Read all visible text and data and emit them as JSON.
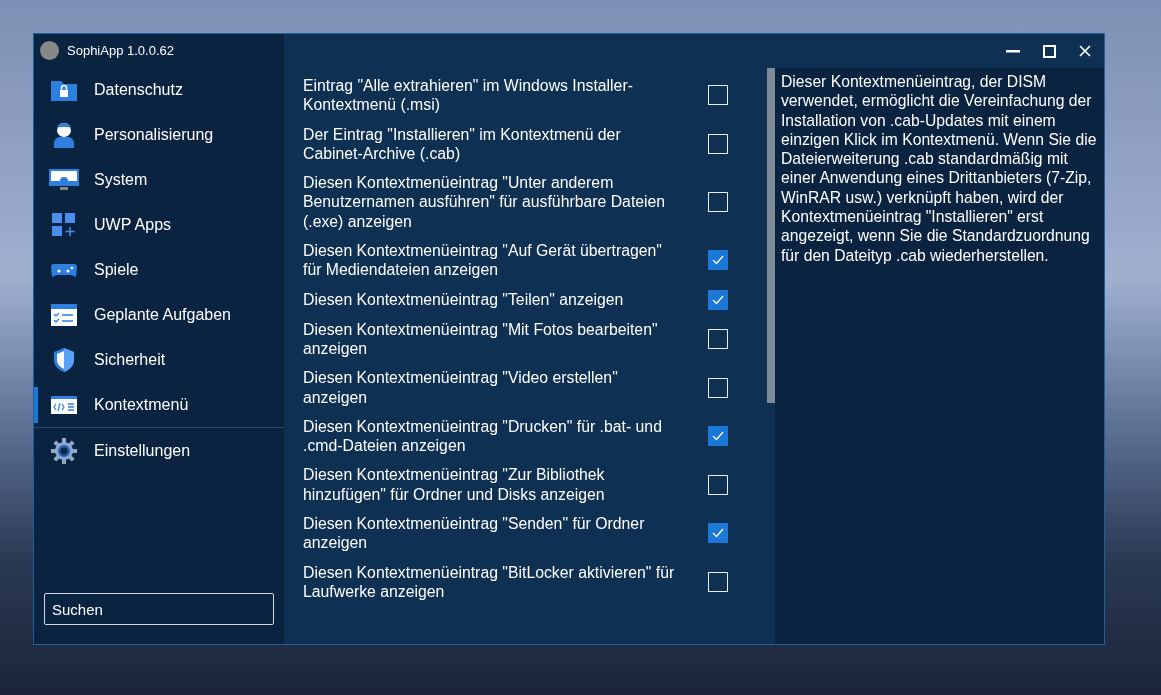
{
  "window": {
    "title": "SophiApp 1.0.0.62"
  },
  "sidebar": {
    "items": [
      {
        "label": "Datenschutz",
        "selected": false
      },
      {
        "label": "Personalisierung",
        "selected": false
      },
      {
        "label": "System",
        "selected": false
      },
      {
        "label": "UWP Apps",
        "selected": false
      },
      {
        "label": "Spiele",
        "selected": false
      },
      {
        "label": "Geplante Aufgaben",
        "selected": false
      },
      {
        "label": "Sicherheit",
        "selected": false
      },
      {
        "label": "Kontextmenü",
        "selected": true
      }
    ],
    "footer_item": {
      "label": "Einstellungen"
    },
    "search": {
      "placeholder": "Suchen"
    }
  },
  "options": [
    {
      "label": "Eintrag \"Alle extrahieren\" im Windows Installer-Kontextmenü (.msi)",
      "checked": false
    },
    {
      "label": "Der Eintrag \"Installieren\" im Kontextmenü der Cabinet-Archive (.cab)",
      "checked": false
    },
    {
      "label": "Diesen Kontextmenüeintrag \"Unter anderem Benutzernamen ausführen\" für ausführbare Dateien (.exe) anzeigen",
      "checked": false
    },
    {
      "label": "Diesen Kontextmenüeintrag \"Auf Gerät übertragen\" für Mediendateien anzeigen",
      "checked": true
    },
    {
      "label": "Diesen Kontextmenüeintrag \"Teilen\" anzeigen",
      "checked": true
    },
    {
      "label": "Diesen Kontextmenüeintrag \"Mit Fotos bearbeiten\" anzeigen",
      "checked": false
    },
    {
      "label": "Diesen Kontextmenüeintrag \"Video erstellen\" anzeigen",
      "checked": false
    },
    {
      "label": "Diesen Kontextmenüeintrag \"Drucken\" für .bat- und .cmd-Dateien anzeigen",
      "checked": true
    },
    {
      "label": "Diesen Kontextmenüeintrag \"Zur Bibliothek hinzufügen\" für Ordner und Disks anzeigen",
      "checked": false
    },
    {
      "label": "Diesen Kontextmenüeintrag \"Senden\" für Ordner anzeigen",
      "checked": true
    },
    {
      "label": "Diesen Kontextmenüeintrag \"BitLocker aktivieren\" für Laufwerke anzeigen",
      "checked": false
    }
  ],
  "description": "Dieser Kontextmenüeintrag, der DISM verwendet, ermöglicht die Vereinfachung der Installation von .cab-Updates mit einem einzigen Klick im Kontextmenü. Wenn Sie die Dateierweiterung .cab standardmäßig mit einer Anwendung eines Drittanbieters (7-Zip, WinRAR usw.) verknüpft haben, wird der Kontextmenüeintrag \"Installieren\" erst angezeigt, wenn Sie die Standardzuordnung für den Dateityp .cab wiederherstellen."
}
